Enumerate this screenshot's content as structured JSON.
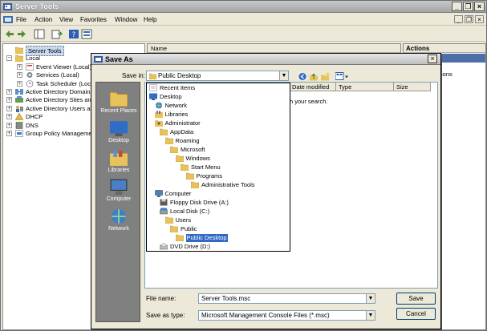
{
  "window": {
    "title": "Server Tools",
    "controls": {
      "minimize": "_",
      "restore": "❐",
      "close": "×"
    },
    "inner_controls": {
      "minimize": "_",
      "restore": "❐",
      "close": "×"
    }
  },
  "menu": {
    "items": [
      "File",
      "Action",
      "View",
      "Favorites",
      "Window",
      "Help"
    ]
  },
  "tree": {
    "items": [
      {
        "label": "Server Tools",
        "level": 0,
        "expander": "",
        "icon": "folder-icon",
        "selected": true
      },
      {
        "label": "Local",
        "level": 0,
        "expander": "−",
        "icon": "folder-icon"
      },
      {
        "label": "Event Viewer (Local)",
        "level": 1,
        "expander": "+",
        "icon": "event-viewer-icon"
      },
      {
        "label": "Services (Local)",
        "level": 1,
        "expander": "+",
        "icon": "services-icon"
      },
      {
        "label": "Task Scheduler (Local)",
        "level": 1,
        "expander": "+",
        "icon": "task-scheduler-icon"
      },
      {
        "label": "Active Directory Domains and Trusts",
        "level": 0,
        "expander": "+",
        "icon": "ad-domains-icon"
      },
      {
        "label": "Active Directory Sites and Services",
        "level": 0,
        "expander": "+",
        "icon": "ad-sites-icon"
      },
      {
        "label": "Active Directory Users and Computers",
        "level": 0,
        "expander": "+",
        "icon": "ad-users-icon"
      },
      {
        "label": "DHCP",
        "level": 0,
        "expander": "+",
        "icon": "dhcp-icon"
      },
      {
        "label": "DNS",
        "level": 0,
        "expander": "+",
        "icon": "dns-icon"
      },
      {
        "label": "Group Policy Management",
        "level": 0,
        "expander": "+",
        "icon": "group-policy-icon"
      }
    ]
  },
  "list": {
    "name_header": "Name"
  },
  "actions": {
    "header": "Actions",
    "fragment": "ions"
  },
  "dialog": {
    "title": "Save As",
    "close": "×",
    "save_in_label": "Save in:",
    "save_in_value": "Public Desktop",
    "places": [
      {
        "label": "Recent Places",
        "icon": "recent-places-icon"
      },
      {
        "label": "Desktop",
        "icon": "desktop-icon"
      },
      {
        "label": "Libraries",
        "icon": "libraries-icon"
      },
      {
        "label": "Computer",
        "icon": "computer-icon"
      },
      {
        "label": "Network",
        "icon": "network-icon"
      }
    ],
    "columns": {
      "date": "Date modified",
      "type": "Type",
      "size": "Size"
    },
    "search_msg": "h your search.",
    "dropdown": [
      {
        "label": "Recent Items",
        "indent": 0,
        "icon": "recent-items-icon"
      },
      {
        "label": "Desktop",
        "indent": 0,
        "icon": "desktop-icon"
      },
      {
        "label": "Network",
        "indent": 1,
        "icon": "network-icon"
      },
      {
        "label": "Libraries",
        "indent": 1,
        "icon": "libraries-icon"
      },
      {
        "label": "Administrator",
        "indent": 1,
        "icon": "user-folder-icon"
      },
      {
        "label": "AppData",
        "indent": 2,
        "icon": "folder-icon"
      },
      {
        "label": "Roaming",
        "indent": 3,
        "icon": "folder-icon"
      },
      {
        "label": "Microsoft",
        "indent": 4,
        "icon": "folder-icon"
      },
      {
        "label": "Windows",
        "indent": 5,
        "icon": "folder-icon"
      },
      {
        "label": "Start Menu",
        "indent": 6,
        "icon": "folder-icon"
      },
      {
        "label": "Programs",
        "indent": 7,
        "icon": "folder-icon"
      },
      {
        "label": "Administrative Tools",
        "indent": 8,
        "icon": "folder-icon"
      },
      {
        "label": "Computer",
        "indent": 1,
        "icon": "computer-icon"
      },
      {
        "label": "Floppy Disk Drive (A:)",
        "indent": 2,
        "icon": "floppy-icon"
      },
      {
        "label": "Local Disk (C:)",
        "indent": 2,
        "icon": "hard-disk-icon"
      },
      {
        "label": "Users",
        "indent": 3,
        "icon": "folder-icon"
      },
      {
        "label": "Public",
        "indent": 4,
        "icon": "folder-icon"
      },
      {
        "label": "Public Desktop",
        "indent": 5,
        "icon": "folder-icon",
        "selected": true
      },
      {
        "label": "DVD Drive (D:)",
        "indent": 2,
        "icon": "dvd-icon"
      }
    ],
    "file_name_label": "File name:",
    "file_name_value": "Server Tools.msc",
    "save_type_label": "Save as type:",
    "save_type_value": "Microsoft Management Console Files (*.msc)",
    "save_button": "Save",
    "cancel_button": "Cancel"
  },
  "colors": {
    "selection": "#316ac5",
    "accent": "#4e6ea8",
    "places_bg": "#808080"
  }
}
